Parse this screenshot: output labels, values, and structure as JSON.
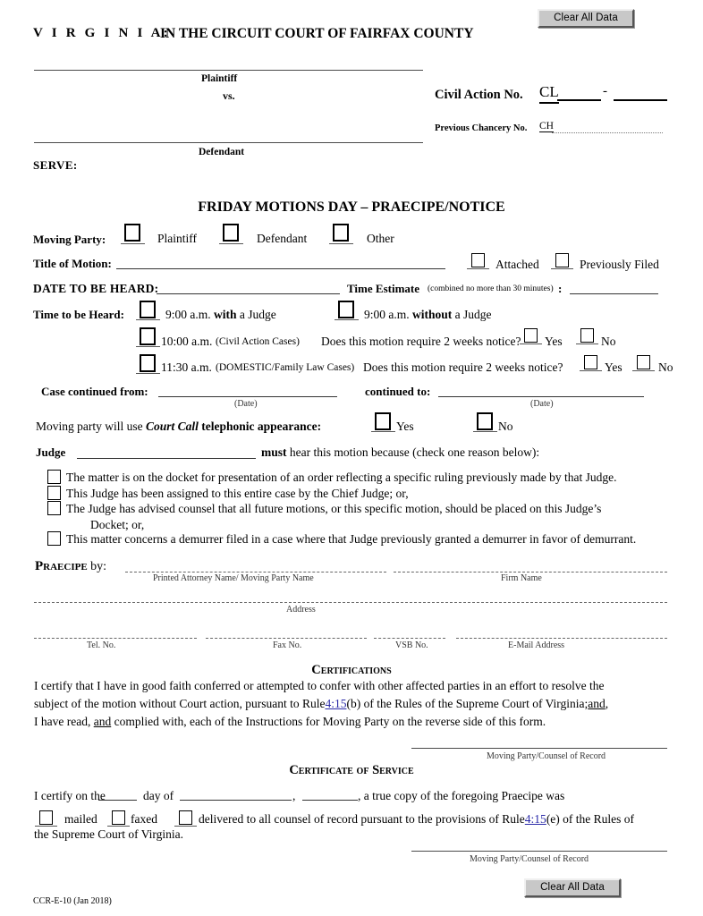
{
  "buttons": {
    "clear_all_top": "Clear All Data",
    "clear_all_bottom": "Clear All Data"
  },
  "header": {
    "state": "V I R G I N I A:",
    "court": "IN THE CIRCUIT COURT OF FAIRFAX COUNTY"
  },
  "caption": {
    "plaintiff_label": "Plaintiff",
    "vs_label": "vs.",
    "defendant_label": "Defendant",
    "serve_label": "SERVE:",
    "civil_action_label": "Civil Action No.",
    "civil_action_prefix": "CL",
    "civil_action_dash": "-",
    "chancery_label": "Previous Chancery No.",
    "chancery_prefix": "CH"
  },
  "form_title": "FRIDAY MOTIONS DAY – PRAECIPE/NOTICE",
  "moving_party": {
    "label": "Moving Party:",
    "options": [
      "Plaintiff",
      "Defendant",
      "Other"
    ]
  },
  "title_of_motion": {
    "label": "Title of Motion:",
    "value": "",
    "attached_label": "Attached",
    "previously_filed_label": "Previously Filed"
  },
  "date_to_be_heard": {
    "label": "DATE TO BE HEARD:",
    "value": "",
    "time_estimate_label": "Time Estimate",
    "time_estimate_note": "(combined no more than 30 minutes)",
    "time_estimate_colon": ":",
    "time_estimate_value": ""
  },
  "time_to_be_heard": {
    "label": "Time to be Heard:",
    "option_900_with_pre": "9:00 a.m.",
    "option_900_with_bold": "with",
    "option_900_with_post": "a Judge",
    "option_900_without_pre": "9:00 a.m.",
    "option_900_without_bold": "without",
    "option_900_without_post": "a Judge",
    "option_1000": "10:00 a.m.",
    "option_1000_note": "(Civil Action Cases)",
    "option_1000_question": "Does this motion require 2 weeks notice?",
    "option_1130": "11:30 a.m.",
    "option_1130_note": "(DOMESTIC/Family Law Cases)",
    "option_1130_question": "Does this motion require 2 weeks notice?",
    "yes_label": "Yes",
    "no_label": "No"
  },
  "case_continued": {
    "from_label": "Case continued from:",
    "to_label": "continued to:",
    "date_caption": "(Date)"
  },
  "court_call": {
    "text_pre": "Moving party will use",
    "text_italic": "Court Call",
    "text_post": "telephonic appearance",
    "colon": ":",
    "yes_label": "Yes",
    "no_label": "No"
  },
  "judge": {
    "label": "Judge",
    "must_bold": "must",
    "text_post": "hear this motion because (check one reason below):",
    "reasons": [
      "The matter is on the docket for presentation of an order reflecting a specific ruling previously made by that Judge.",
      "This Judge has been assigned to this entire case by the Chief Judge; or,",
      "The Judge has advised counsel that all future motions, or this specific motion, should be placed on this Judge’s",
      "Docket; or,",
      "This matter concerns a demurrer filed in a case where that Judge previously granted a demurrer in favor of demurrant."
    ]
  },
  "praecipe": {
    "label": "Praecipe",
    "by_label": "by:",
    "caption_attorney": "Printed Attorney Name/ Moving Party Name",
    "caption_firm": "Firm Name",
    "caption_address": "Address",
    "caption_tel": "Tel. No.",
    "caption_fax": "Fax No.",
    "caption_vsb": "VSB No.",
    "caption_email": "E-Mail Address"
  },
  "certifications": {
    "heading": "Certifications",
    "line1": "I certify that I have in good faith conferred or attempted to confer with other affected parties in an effort to resolve the",
    "line2_pre": "subject of the motion without Court action, pursuant to Rule",
    "line2_link": "4:15",
    "line2_mid": "(b) of the Rules of the Supreme Court of Virginia;",
    "line2_underlined": "and",
    "line2_post": ",",
    "line3_pre": "I have read,",
    "line3_underlined": "and",
    "line3_post": "complied with, each of the Instructions for Moving Party on the reverse side of this form.",
    "signature_caption": "Moving Party/Counsel of Record"
  },
  "certificate_of_service": {
    "heading": "Certificate of Service",
    "line1_pre": "I certify on the",
    "line1_mid1": "day of",
    "line1_mid2": ",",
    "line1_post": ", a true copy of the foregoing Praecipe was",
    "mailed_label": "mailed",
    "faxed_label": "faxed",
    "delivered_text": "delivered to all counsel of record pursuant to the provisions of Rule",
    "rule_link": "4:15",
    "rule_post": "(e) of the Rules of",
    "line2": "the Supreme Court of Virginia.",
    "signature_caption": "Moving Party/Counsel of Record"
  },
  "footer": {
    "form_code": "CCR-E-10 (Jan 2018)"
  }
}
